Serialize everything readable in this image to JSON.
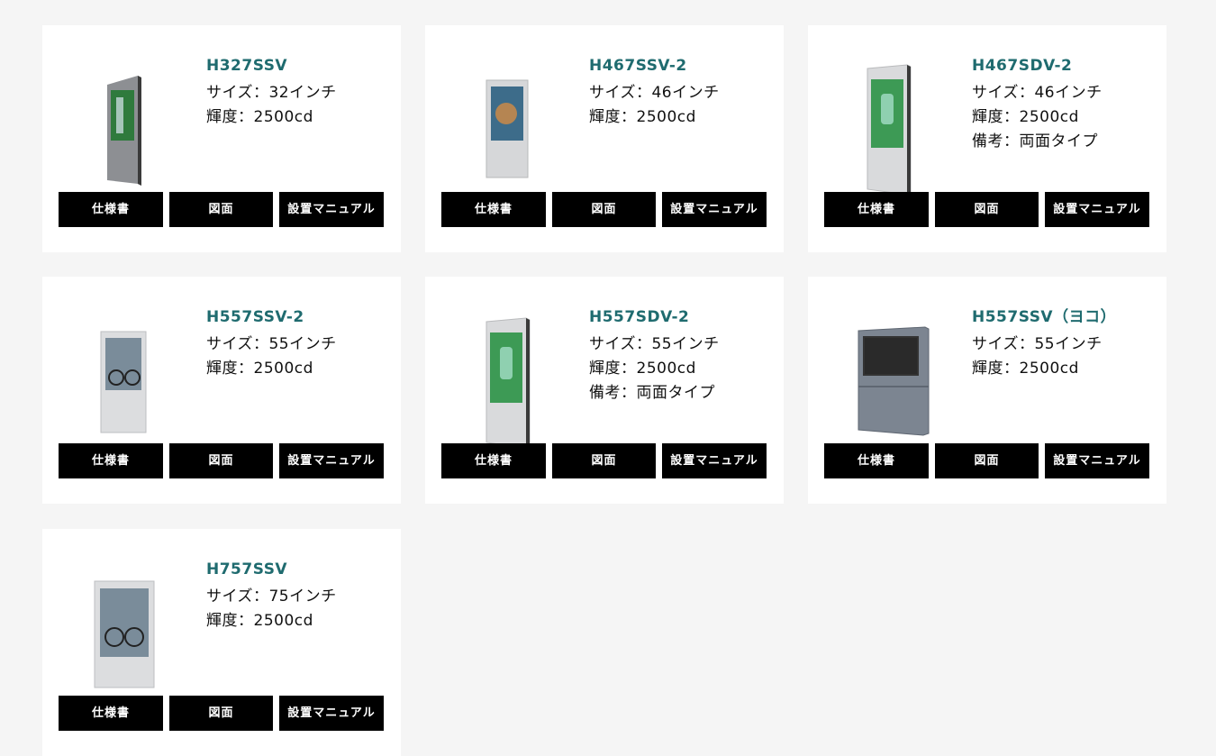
{
  "buttons": {
    "spec": "仕様書",
    "drawing": "図面",
    "manual": "設置マニュアル"
  },
  "products": [
    {
      "model": "H327SSV",
      "specs": [
        "サイズ：32インチ",
        "輝度：2500cd"
      ],
      "image": "kiosk-icon",
      "screen_color": "#2f7a3d"
    },
    {
      "model": "H467SSV-2",
      "specs": [
        "サイズ：46インチ",
        "輝度：2500cd"
      ],
      "image": "kiosk-icon",
      "screen_color": "#3d6c8a"
    },
    {
      "model": "H467SDV-2",
      "specs": [
        "サイズ：46インチ",
        "輝度：2500cd",
        "備考：両面タイプ"
      ],
      "image": "kiosk-icon",
      "screen_color": "#3d9a55"
    },
    {
      "model": "H557SSV-2",
      "specs": [
        "サイズ：55インチ",
        "輝度：2500cd"
      ],
      "image": "kiosk-icon",
      "screen_color": "#7a8c9a"
    },
    {
      "model": "H557SDV-2",
      "specs": [
        "サイズ：55インチ",
        "輝度：2500cd",
        "備考：両面タイプ"
      ],
      "image": "kiosk-icon",
      "screen_color": "#3d9a55"
    },
    {
      "model": "H557SSV（ヨコ）",
      "specs": [
        "サイズ：55インチ",
        "輝度：2500cd"
      ],
      "image": "kiosk-icon",
      "screen_color": "#333333"
    },
    {
      "model": "H757SSV",
      "specs": [
        "サイズ：75インチ",
        "輝度：2500cd"
      ],
      "image": "kiosk-icon",
      "screen_color": "#7a8c9a"
    }
  ]
}
